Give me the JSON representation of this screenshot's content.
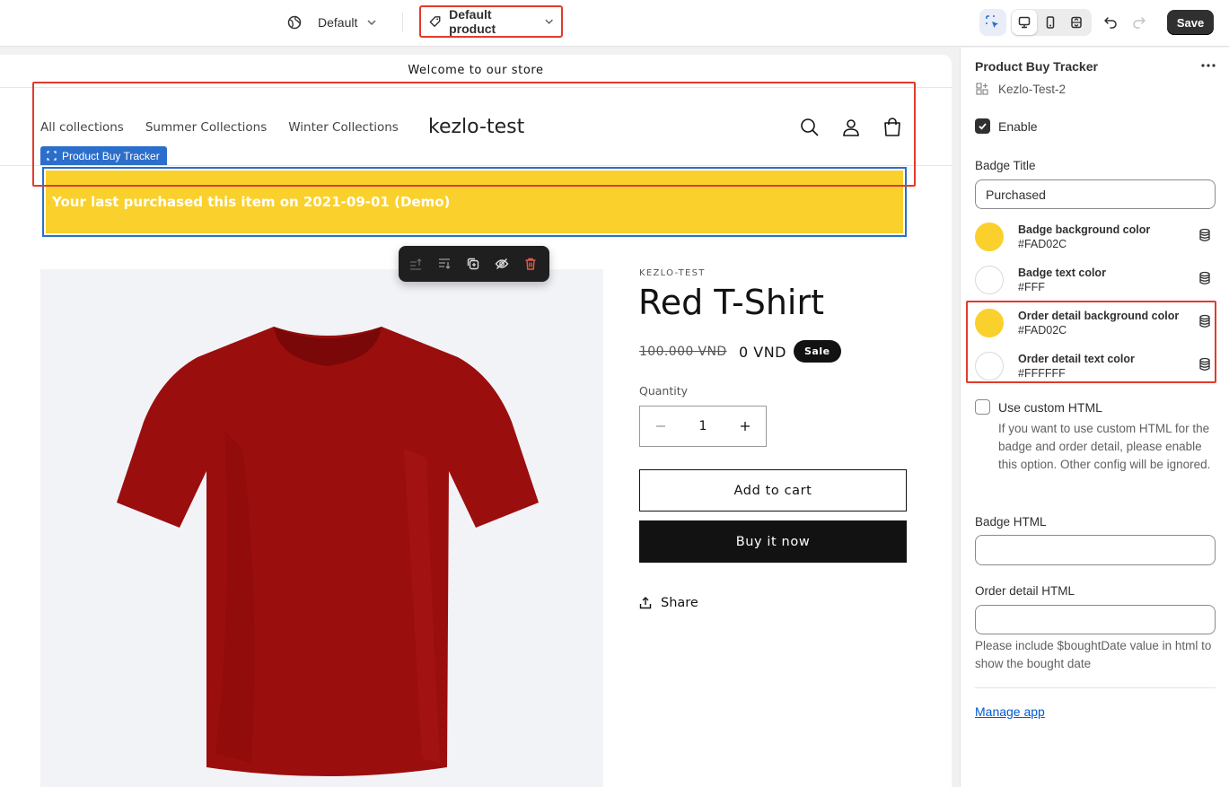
{
  "topbar": {
    "theme_label": "Default",
    "template_label": "Default product",
    "save_label": "Save"
  },
  "store": {
    "announcement": "Welcome to our store",
    "nav": [
      "All collections",
      "Summer Collections",
      "Winter Collections"
    ],
    "logo": "kezlo-test"
  },
  "block": {
    "tag_label": "Product Buy Tracker",
    "badge_text": "Your last purchased this item on 2021-09-01 (Demo)"
  },
  "product": {
    "vendor": "KEZLO-TEST",
    "title": "Red T-Shirt",
    "price_old": "100.000 VND",
    "price_new": "0 VND",
    "sale_badge": "Sale",
    "quantity_label": "Quantity",
    "quantity_value": "1",
    "add_to_cart": "Add to cart",
    "buy_now": "Buy it now",
    "share": "Share"
  },
  "panel": {
    "title": "Product Buy Tracker",
    "app_name": "Kezlo-Test-2",
    "enable_label": "Enable",
    "badge_title_label": "Badge Title",
    "badge_title_value": "Purchased",
    "colors": [
      {
        "name": "Badge background color",
        "value": "#FAD02C",
        "swatch": "#FAD02C"
      },
      {
        "name": "Badge text color",
        "value": "#FFF",
        "swatch": "#FFFFFF"
      },
      {
        "name": "Order detail background color",
        "value": "#FAD02C",
        "swatch": "#FAD02C"
      },
      {
        "name": "Order detail text color",
        "value": "#FFFFFF",
        "swatch": "#FFFFFF"
      }
    ],
    "custom_html_label": "Use custom HTML",
    "custom_html_help": "If you want to use custom HTML for the badge and order detail, please enable this option. Other config will be ignored.",
    "badge_html_label": "Badge HTML",
    "badge_html_value": "",
    "order_html_label": "Order detail HTML",
    "order_html_value": "",
    "order_html_help": "Please include $boughtDate value in html to show the bought date",
    "manage_link": "Manage app"
  },
  "colors": {
    "accent": "#2c6ecb",
    "highlight": "#e03b2b",
    "badge_bg": "#FAD02C"
  }
}
